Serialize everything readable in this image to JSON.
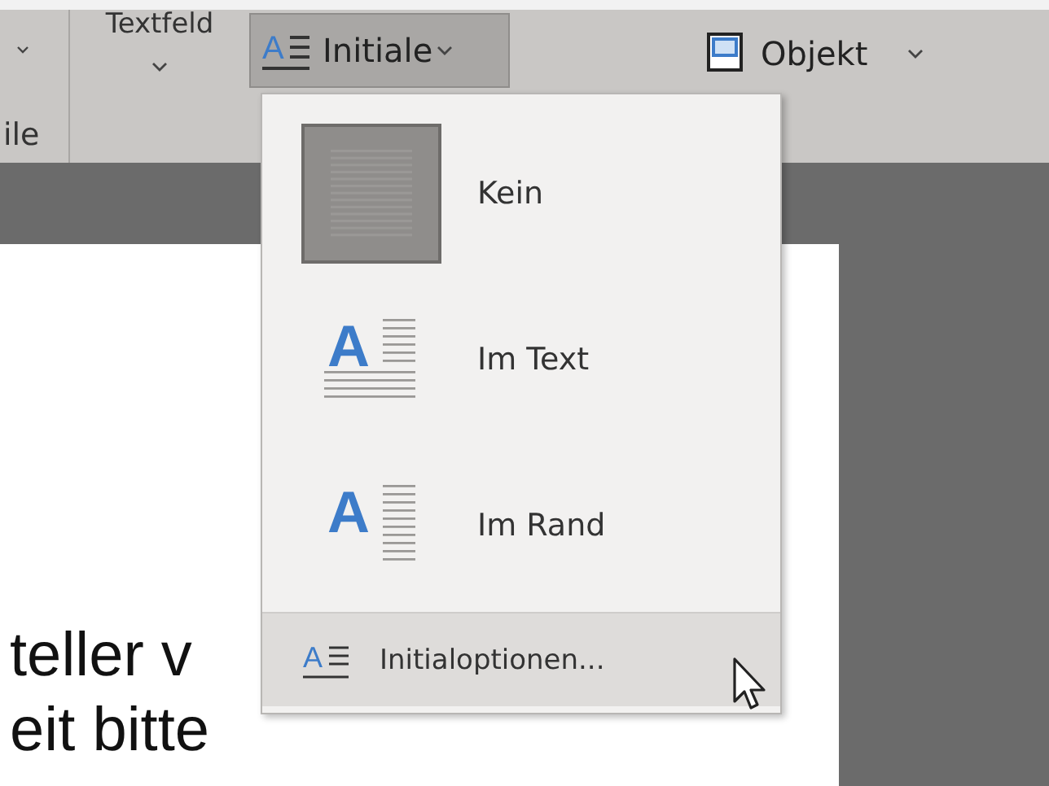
{
  "ribbon": {
    "group_label": "ile",
    "textbox_button": {
      "label": "Textfeld"
    },
    "dropcap_button": {
      "label": "Initiale",
      "icon_letter": "A",
      "selected": true
    },
    "object_button": {
      "label": "Objekt"
    }
  },
  "document": {
    "lines": [
      "teller v",
      "eit bitte"
    ]
  },
  "dropcap_menu": {
    "items": [
      {
        "kind": "none",
        "label": "Kein",
        "selected": true
      },
      {
        "kind": "in-text",
        "label": "Im Text",
        "icon_letter": "A",
        "selected": false
      },
      {
        "kind": "in-margin",
        "label": "Im Rand",
        "icon_letter": "A",
        "selected": false
      }
    ],
    "footer": {
      "label": "Initialoptionen...",
      "icon_letter": "A",
      "hovered": true
    }
  }
}
